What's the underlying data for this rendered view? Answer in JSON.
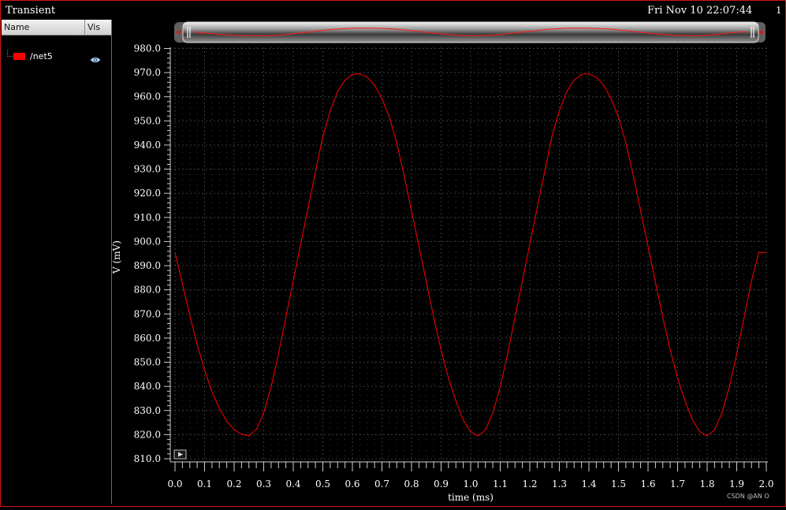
{
  "window": {
    "title": "Transient",
    "datetime": "Fri Nov 10 22:07:44",
    "page_number": "1"
  },
  "signal_list": {
    "columns": [
      "Name",
      "Vis"
    ],
    "signals": [
      {
        "name": "/net5",
        "color": "#ff0000",
        "visible": true,
        "icon": "eye-icon"
      }
    ]
  },
  "watermark": "CSDN @AN O",
  "colors": {
    "trace": "#ff0000",
    "frame": "#d01818",
    "grid": "#3c3c3c",
    "background": "#000000"
  },
  "chart_data": {
    "type": "line",
    "xlabel": "time (ms)",
    "ylabel": "V (mV)",
    "xlim": [
      0,
      2.0
    ],
    "ylim": [
      810,
      980
    ],
    "x_ticks": [
      "0.0",
      "0.1",
      "0.2",
      "0.3",
      "0.4",
      "0.5",
      "0.6",
      "0.7",
      "0.8",
      "0.9",
      "1.0",
      "1.1",
      "1.2",
      "1.3",
      "1.4",
      "1.5",
      "1.6",
      "1.7",
      "1.8",
      "1.9",
      "2.0"
    ],
    "y_ticks": [
      "980.0",
      "970.0",
      "960.0",
      "950.0",
      "940.0",
      "930.0",
      "920.0",
      "910.0",
      "900.0",
      "890.0",
      "880.0",
      "870.0",
      "860.0",
      "850.0",
      "840.0",
      "830.0",
      "820.0",
      "810.0"
    ],
    "grid": true,
    "series": [
      {
        "name": "/net5",
        "x": [
          0.0,
          0.025,
          0.05,
          0.075,
          0.1,
          0.125,
          0.15,
          0.175,
          0.2,
          0.225,
          0.25,
          0.275,
          0.3,
          0.325,
          0.35,
          0.375,
          0.4,
          0.425,
          0.45,
          0.475,
          0.5,
          0.525,
          0.55,
          0.575,
          0.6,
          0.625,
          0.65,
          0.675,
          0.7,
          0.725,
          0.75,
          0.775,
          0.8,
          0.825,
          0.85,
          0.875,
          0.9,
          0.925,
          0.95,
          0.975,
          1.0,
          1.025,
          1.05,
          1.075,
          1.1,
          1.125,
          1.15,
          1.175,
          1.2,
          1.225,
          1.25,
          1.275,
          1.3,
          1.325,
          1.35,
          1.375,
          1.4,
          1.425,
          1.45,
          1.475,
          1.5,
          1.525,
          1.55,
          1.575,
          1.6,
          1.625,
          1.65,
          1.675,
          1.7,
          1.725,
          1.75,
          1.775,
          1.8,
          1.825,
          1.85,
          1.875,
          1.9,
          1.925,
          1.95,
          1.975,
          2.0
        ],
        "y": [
          895.5,
          882.4,
          869.3,
          857.3,
          846.7,
          837.8,
          830.8,
          825.6,
          822.1,
          820.2,
          819.5,
          822.1,
          829.0,
          839.8,
          853.5,
          868.7,
          883.8,
          898.9,
          914.0,
          928.9,
          943.5,
          954.2,
          962.2,
          966.9,
          969.3,
          969.5,
          968.1,
          964.8,
          959.3,
          951.6,
          940.8,
          927.4,
          912.7,
          898.0,
          883.2,
          868.6,
          855.1,
          843.4,
          833.9,
          826.1,
          821.2,
          819.5,
          821.9,
          829.0,
          839.8,
          853.5,
          868.7,
          883.8,
          898.9,
          914.0,
          928.9,
          943.5,
          954.2,
          962.2,
          966.9,
          969.3,
          969.5,
          968.1,
          964.8,
          959.3,
          951.6,
          940.8,
          927.4,
          912.7,
          898.0,
          883.2,
          868.6,
          855.1,
          843.4,
          833.9,
          826.1,
          821.2,
          819.5,
          821.9,
          829.0,
          839.8,
          853.5,
          868.7,
          883.8,
          895.5,
          895.5
        ]
      }
    ]
  }
}
